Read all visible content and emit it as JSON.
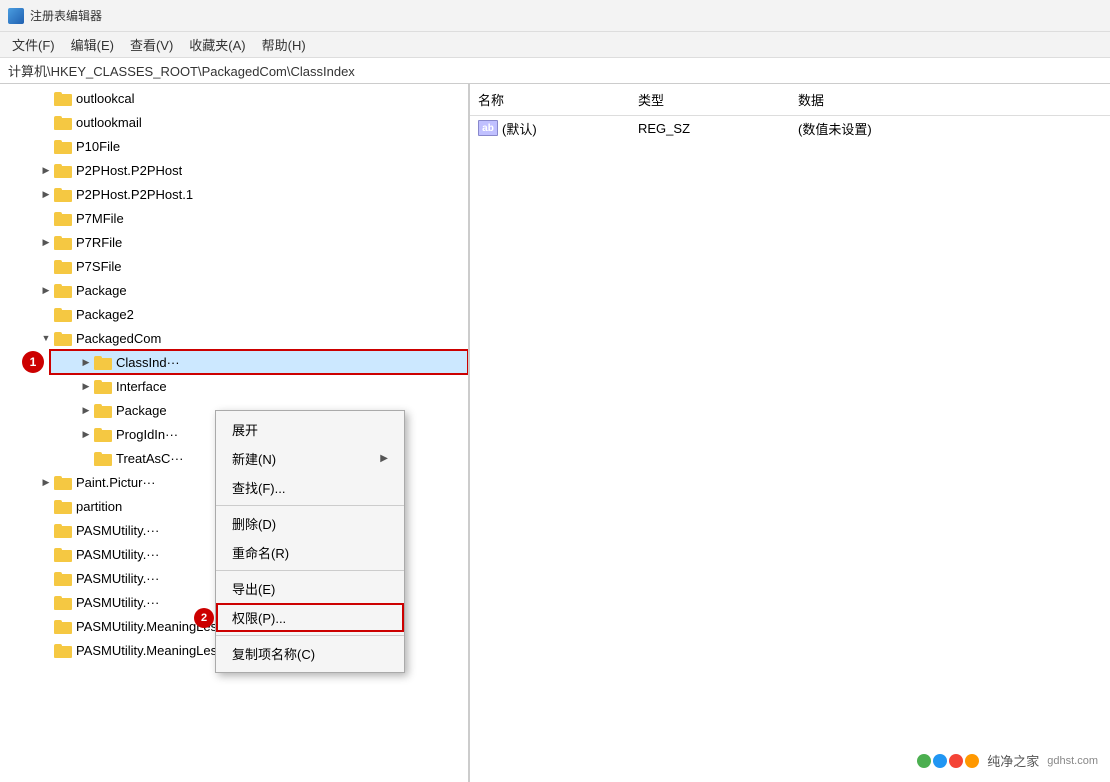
{
  "titleBar": {
    "title": "注册表编辑器"
  },
  "menuBar": {
    "items": [
      {
        "label": "文件(F)"
      },
      {
        "label": "编辑(E)"
      },
      {
        "label": "查看(V)"
      },
      {
        "label": "收藏夹(A)"
      },
      {
        "label": "帮助(H)"
      }
    ]
  },
  "addressBar": {
    "path": "计算机\\HKEY_CLASSES_ROOT\\PackagedCom\\ClassIndex"
  },
  "treeItems": [
    {
      "label": "outlookcal",
      "indent": 1,
      "expandable": false
    },
    {
      "label": "outlookmail",
      "indent": 1,
      "expandable": false
    },
    {
      "label": "P10File",
      "indent": 1,
      "expandable": false
    },
    {
      "label": "P2PHost.P2PHost",
      "indent": 1,
      "expandable": true
    },
    {
      "label": "P2PHost.P2PHost.1",
      "indent": 1,
      "expandable": true
    },
    {
      "label": "P7MFile",
      "indent": 1,
      "expandable": false
    },
    {
      "label": "P7RFile",
      "indent": 1,
      "expandable": true
    },
    {
      "label": "P7SFile",
      "indent": 1,
      "expandable": false
    },
    {
      "label": "Package",
      "indent": 1,
      "expandable": true
    },
    {
      "label": "Package2",
      "indent": 1,
      "expandable": false
    },
    {
      "label": "PackagedCom",
      "indent": 1,
      "expandable": true,
      "expanded": true
    },
    {
      "label": "ClassInd···",
      "indent": 2,
      "expandable": true,
      "selected": true,
      "badge": "1"
    },
    {
      "label": "Interface",
      "indent": 2,
      "expandable": true
    },
    {
      "label": "Package",
      "indent": 2,
      "expandable": true
    },
    {
      "label": "ProgIdIn···",
      "indent": 2,
      "expandable": true
    },
    {
      "label": "TreatAsC···",
      "indent": 2,
      "expandable": false
    },
    {
      "label": "Paint.Pictur···",
      "indent": 1,
      "expandable": true
    },
    {
      "label": "partition",
      "indent": 1,
      "expandable": false
    },
    {
      "label": "PASMUtility.···",
      "indent": 1,
      "expandable": false
    },
    {
      "label": "PASMUtility.···",
      "indent": 1,
      "expandable": false
    },
    {
      "label": "PASMUtility.···",
      "indent": 1,
      "expandable": false
    },
    {
      "label": "PASMUtility.···",
      "indent": 1,
      "expandable": false
    },
    {
      "label": "PASMUtility.MeaningLess3",
      "indent": 1,
      "expandable": false
    },
    {
      "label": "PASMUtility.MeaningLess3.2",
      "indent": 1,
      "expandable": false
    }
  ],
  "rightPanel": {
    "columns": [
      "名称",
      "类型",
      "数据"
    ],
    "rows": [
      {
        "name": "(默认)",
        "type": "REG_SZ",
        "data": "(数值未设置)",
        "icon": "ab"
      }
    ]
  },
  "contextMenu": {
    "items": [
      {
        "label": "展开",
        "type": "item",
        "hasArrow": false
      },
      {
        "label": "新建(N)",
        "type": "item",
        "hasArrow": true
      },
      {
        "label": "查找(F)...",
        "type": "item",
        "hasArrow": false
      },
      {
        "separator": true
      },
      {
        "label": "删除(D)",
        "type": "item",
        "hasArrow": false
      },
      {
        "label": "重命名(R)",
        "type": "item",
        "hasArrow": false
      },
      {
        "separator": true
      },
      {
        "label": "导出(E)",
        "type": "item",
        "hasArrow": false
      },
      {
        "label": "权限(P)...",
        "type": "item",
        "hasArrow": false,
        "highlighted": true,
        "badge": "2"
      },
      {
        "separator": true
      },
      {
        "label": "复制项名称(C)",
        "type": "item",
        "hasArrow": false
      }
    ]
  },
  "watermark": {
    "text": "纯净之家",
    "url": "gdhs t.com"
  },
  "colors": {
    "folderYellow": "#f5c842",
    "accent": "#0078d7",
    "badgeRed": "#cc0000"
  }
}
